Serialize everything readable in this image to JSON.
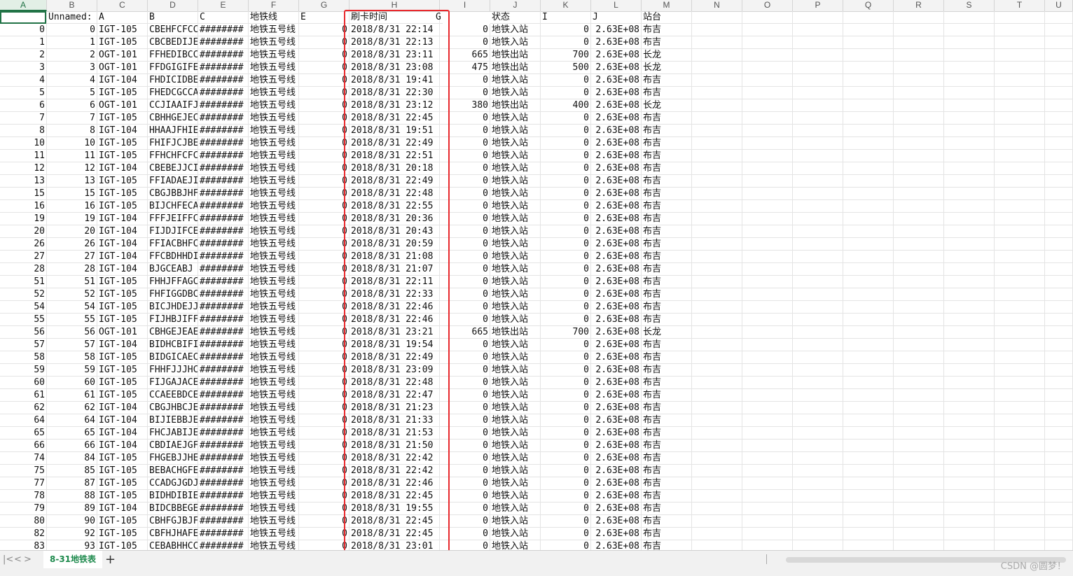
{
  "columns": [
    "A",
    "B",
    "C",
    "D",
    "E",
    "F",
    "G",
    "H",
    "I",
    "J",
    "K",
    "L",
    "M",
    "N",
    "O",
    "P",
    "Q",
    "R",
    "S",
    "T",
    "U"
  ],
  "header_row": {
    "B": "Unnamed:",
    "C": "A",
    "D": "B",
    "E": "C",
    "F": "地铁线",
    "G": "E",
    "H": "刷卡时间",
    "H_tail": "G",
    "J": "状态",
    "K": "I",
    "L": "J",
    "M": "站台"
  },
  "rows": [
    {
      "n": "0",
      "b": "0",
      "c": "IGT-105",
      "d": "CBEHFCFCC",
      "e": "########",
      "f": "地铁五号线",
      "g": "0",
      "h": "2018/8/31  22:14",
      "i": "0",
      "j": "地铁入站",
      "k": "0",
      "l": "2.63E+08",
      "m": "布吉"
    },
    {
      "n": "1",
      "b": "1",
      "c": "IGT-105",
      "d": "CBCBEDIJE",
      "e": "########",
      "f": "地铁五号线",
      "g": "0",
      "h": "2018/8/31  22:13",
      "i": "0",
      "j": "地铁入站",
      "k": "0",
      "l": "2.63E+08",
      "m": "布吉"
    },
    {
      "n": "2",
      "b": "2",
      "c": "OGT-101",
      "d": "FFHEDIBCC",
      "e": "########",
      "f": "地铁五号线",
      "g": "0",
      "h": "2018/8/31  23:11",
      "i": "665",
      "j": "地铁出站",
      "k": "700",
      "l": "2.63E+08",
      "m": "长龙"
    },
    {
      "n": "3",
      "b": "3",
      "c": "OGT-101",
      "d": "FFDGIGIFE",
      "e": "########",
      "f": "地铁五号线",
      "g": "0",
      "h": "2018/8/31  23:08",
      "i": "475",
      "j": "地铁出站",
      "k": "500",
      "l": "2.63E+08",
      "m": "长龙"
    },
    {
      "n": "4",
      "b": "4",
      "c": "IGT-104",
      "d": "FHDICIDBE",
      "e": "########",
      "f": "地铁五号线",
      "g": "0",
      "h": "2018/8/31  19:41",
      "i": "0",
      "j": "地铁入站",
      "k": "0",
      "l": "2.63E+08",
      "m": "布吉"
    },
    {
      "n": "5",
      "b": "5",
      "c": "IGT-105",
      "d": "FHEDCGCCA",
      "e": "########",
      "f": "地铁五号线",
      "g": "0",
      "h": "2018/8/31  22:30",
      "i": "0",
      "j": "地铁入站",
      "k": "0",
      "l": "2.63E+08",
      "m": "布吉"
    },
    {
      "n": "6",
      "b": "6",
      "c": "OGT-101",
      "d": "CCJIAAIFJ",
      "e": "########",
      "f": "地铁五号线",
      "g": "0",
      "h": "2018/8/31  23:12",
      "i": "380",
      "j": "地铁出站",
      "k": "400",
      "l": "2.63E+08",
      "m": "长龙"
    },
    {
      "n": "7",
      "b": "7",
      "c": "IGT-105",
      "d": "CBHHGEJEC",
      "e": "########",
      "f": "地铁五号线",
      "g": "0",
      "h": "2018/8/31  22:45",
      "i": "0",
      "j": "地铁入站",
      "k": "0",
      "l": "2.63E+08",
      "m": "布吉"
    },
    {
      "n": "8",
      "b": "8",
      "c": "IGT-104",
      "d": "HHAAJFHIE",
      "e": "########",
      "f": "地铁五号线",
      "g": "0",
      "h": "2018/8/31  19:51",
      "i": "0",
      "j": "地铁入站",
      "k": "0",
      "l": "2.63E+08",
      "m": "布吉"
    },
    {
      "n": "10",
      "b": "10",
      "c": "IGT-105",
      "d": "FHIFJCJBE",
      "e": "########",
      "f": "地铁五号线",
      "g": "0",
      "h": "2018/8/31  22:49",
      "i": "0",
      "j": "地铁入站",
      "k": "0",
      "l": "2.63E+08",
      "m": "布吉"
    },
    {
      "n": "11",
      "b": "11",
      "c": "IGT-105",
      "d": "FFHCHFCFC",
      "e": "########",
      "f": "地铁五号线",
      "g": "0",
      "h": "2018/8/31  22:51",
      "i": "0",
      "j": "地铁入站",
      "k": "0",
      "l": "2.63E+08",
      "m": "布吉"
    },
    {
      "n": "12",
      "b": "12",
      "c": "IGT-104",
      "d": "CBEBEJJCI",
      "e": "########",
      "f": "地铁五号线",
      "g": "0",
      "h": "2018/8/31  20:18",
      "i": "0",
      "j": "地铁入站",
      "k": "0",
      "l": "2.63E+08",
      "m": "布吉"
    },
    {
      "n": "13",
      "b": "13",
      "c": "IGT-105",
      "d": "FFIADAEJI",
      "e": "########",
      "f": "地铁五号线",
      "g": "0",
      "h": "2018/8/31  22:49",
      "i": "0",
      "j": "地铁入站",
      "k": "0",
      "l": "2.63E+08",
      "m": "布吉"
    },
    {
      "n": "15",
      "b": "15",
      "c": "IGT-105",
      "d": "CBGJBBJHF",
      "e": "########",
      "f": "地铁五号线",
      "g": "0",
      "h": "2018/8/31  22:48",
      "i": "0",
      "j": "地铁入站",
      "k": "0",
      "l": "2.63E+08",
      "m": "布吉"
    },
    {
      "n": "16",
      "b": "16",
      "c": "IGT-105",
      "d": "BIJCHFECA",
      "e": "########",
      "f": "地铁五号线",
      "g": "0",
      "h": "2018/8/31  22:55",
      "i": "0",
      "j": "地铁入站",
      "k": "0",
      "l": "2.63E+08",
      "m": "布吉"
    },
    {
      "n": "19",
      "b": "19",
      "c": "IGT-104",
      "d": "FFFJEIFFC",
      "e": "########",
      "f": "地铁五号线",
      "g": "0",
      "h": "2018/8/31  20:36",
      "i": "0",
      "j": "地铁入站",
      "k": "0",
      "l": "2.63E+08",
      "m": "布吉"
    },
    {
      "n": "20",
      "b": "20",
      "c": "IGT-104",
      "d": "FIJDJIFCE",
      "e": "########",
      "f": "地铁五号线",
      "g": "0",
      "h": "2018/8/31  20:43",
      "i": "0",
      "j": "地铁入站",
      "k": "0",
      "l": "2.63E+08",
      "m": "布吉"
    },
    {
      "n": "26",
      "b": "26",
      "c": "IGT-104",
      "d": "FFIACBHFC",
      "e": "########",
      "f": "地铁五号线",
      "g": "0",
      "h": "2018/8/31  20:59",
      "i": "0",
      "j": "地铁入站",
      "k": "0",
      "l": "2.63E+08",
      "m": "布吉"
    },
    {
      "n": "27",
      "b": "27",
      "c": "IGT-104",
      "d": "FFCBDHHDI",
      "e": "########",
      "f": "地铁五号线",
      "g": "0",
      "h": "2018/8/31  21:08",
      "i": "0",
      "j": "地铁入站",
      "k": "0",
      "l": "2.63E+08",
      "m": "布吉"
    },
    {
      "n": "28",
      "b": "28",
      "c": "IGT-104",
      "d": "BJGCEABJ",
      "e": "########",
      "f": "地铁五号线",
      "g": "0",
      "h": "2018/8/31  21:07",
      "i": "0",
      "j": "地铁入站",
      "k": "0",
      "l": "2.63E+08",
      "m": "布吉"
    },
    {
      "n": "51",
      "b": "51",
      "c": "IGT-105",
      "d": "FHHJFFAGC",
      "e": "########",
      "f": "地铁五号线",
      "g": "0",
      "h": "2018/8/31  22:11",
      "i": "0",
      "j": "地铁入站",
      "k": "0",
      "l": "2.63E+08",
      "m": "布吉"
    },
    {
      "n": "52",
      "b": "52",
      "c": "IGT-105",
      "d": "FHFIGGDBC",
      "e": "########",
      "f": "地铁五号线",
      "g": "0",
      "h": "2018/8/31  22:33",
      "i": "0",
      "j": "地铁入站",
      "k": "0",
      "l": "2.63E+08",
      "m": "布吉"
    },
    {
      "n": "54",
      "b": "54",
      "c": "IGT-105",
      "d": "BICJHDEJJ",
      "e": "########",
      "f": "地铁五号线",
      "g": "0",
      "h": "2018/8/31  22:46",
      "i": "0",
      "j": "地铁入站",
      "k": "0",
      "l": "2.63E+08",
      "m": "布吉"
    },
    {
      "n": "55",
      "b": "55",
      "c": "IGT-105",
      "d": "FIJHBJIFF",
      "e": "########",
      "f": "地铁五号线",
      "g": "0",
      "h": "2018/8/31  22:46",
      "i": "0",
      "j": "地铁入站",
      "k": "0",
      "l": "2.63E+08",
      "m": "布吉"
    },
    {
      "n": "56",
      "b": "56",
      "c": "OGT-101",
      "d": "CBHGEJEAE",
      "e": "########",
      "f": "地铁五号线",
      "g": "0",
      "h": "2018/8/31  23:21",
      "i": "665",
      "j": "地铁出站",
      "k": "700",
      "l": "2.63E+08",
      "m": "长龙"
    },
    {
      "n": "57",
      "b": "57",
      "c": "IGT-104",
      "d": "BIDHCBIFI",
      "e": "########",
      "f": "地铁五号线",
      "g": "0",
      "h": "2018/8/31  19:54",
      "i": "0",
      "j": "地铁入站",
      "k": "0",
      "l": "2.63E+08",
      "m": "布吉"
    },
    {
      "n": "58",
      "b": "58",
      "c": "IGT-105",
      "d": "BIDGICAEC",
      "e": "########",
      "f": "地铁五号线",
      "g": "0",
      "h": "2018/8/31  22:49",
      "i": "0",
      "j": "地铁入站",
      "k": "0",
      "l": "2.63E+08",
      "m": "布吉"
    },
    {
      "n": "59",
      "b": "59",
      "c": "IGT-105",
      "d": "FHHFJJJHC",
      "e": "########",
      "f": "地铁五号线",
      "g": "0",
      "h": "2018/8/31  23:09",
      "i": "0",
      "j": "地铁入站",
      "k": "0",
      "l": "2.63E+08",
      "m": "布吉"
    },
    {
      "n": "60",
      "b": "60",
      "c": "IGT-105",
      "d": "FIJGAJACE",
      "e": "########",
      "f": "地铁五号线",
      "g": "0",
      "h": "2018/8/31  22:48",
      "i": "0",
      "j": "地铁入站",
      "k": "0",
      "l": "2.63E+08",
      "m": "布吉"
    },
    {
      "n": "61",
      "b": "61",
      "c": "IGT-105",
      "d": "CCAEEBDCE",
      "e": "########",
      "f": "地铁五号线",
      "g": "0",
      "h": "2018/8/31  22:47",
      "i": "0",
      "j": "地铁入站",
      "k": "0",
      "l": "2.63E+08",
      "m": "布吉"
    },
    {
      "n": "62",
      "b": "62",
      "c": "IGT-104",
      "d": "CBGJHBCJE",
      "e": "########",
      "f": "地铁五号线",
      "g": "0",
      "h": "2018/8/31  21:23",
      "i": "0",
      "j": "地铁入站",
      "k": "0",
      "l": "2.63E+08",
      "m": "布吉"
    },
    {
      "n": "64",
      "b": "64",
      "c": "IGT-104",
      "d": "BIJIEBBJE",
      "e": "########",
      "f": "地铁五号线",
      "g": "0",
      "h": "2018/8/31  21:33",
      "i": "0",
      "j": "地铁入站",
      "k": "0",
      "l": "2.63E+08",
      "m": "布吉"
    },
    {
      "n": "65",
      "b": "65",
      "c": "IGT-104",
      "d": "FHCJABIJE",
      "e": "########",
      "f": "地铁五号线",
      "g": "0",
      "h": "2018/8/31  21:53",
      "i": "0",
      "j": "地铁入站",
      "k": "0",
      "l": "2.63E+08",
      "m": "布吉"
    },
    {
      "n": "66",
      "b": "66",
      "c": "IGT-104",
      "d": "CBDIAEJGF",
      "e": "########",
      "f": "地铁五号线",
      "g": "0",
      "h": "2018/8/31  21:50",
      "i": "0",
      "j": "地铁入站",
      "k": "0",
      "l": "2.63E+08",
      "m": "布吉"
    },
    {
      "n": "74",
      "b": "84",
      "c": "IGT-105",
      "d": "FHGEBJJHE",
      "e": "########",
      "f": "地铁五号线",
      "g": "0",
      "h": "2018/8/31  22:42",
      "i": "0",
      "j": "地铁入站",
      "k": "0",
      "l": "2.63E+08",
      "m": "布吉"
    },
    {
      "n": "75",
      "b": "85",
      "c": "IGT-105",
      "d": "BEBACHGFE",
      "e": "########",
      "f": "地铁五号线",
      "g": "0",
      "h": "2018/8/31  22:42",
      "i": "0",
      "j": "地铁入站",
      "k": "0",
      "l": "2.63E+08",
      "m": "布吉"
    },
    {
      "n": "77",
      "b": "87",
      "c": "IGT-105",
      "d": "CCADGJGDJ",
      "e": "########",
      "f": "地铁五号线",
      "g": "0",
      "h": "2018/8/31  22:46",
      "i": "0",
      "j": "地铁入站",
      "k": "0",
      "l": "2.63E+08",
      "m": "布吉"
    },
    {
      "n": "78",
      "b": "88",
      "c": "IGT-105",
      "d": "BIDHDIBIE",
      "e": "########",
      "f": "地铁五号线",
      "g": "0",
      "h": "2018/8/31  22:45",
      "i": "0",
      "j": "地铁入站",
      "k": "0",
      "l": "2.63E+08",
      "m": "布吉"
    },
    {
      "n": "79",
      "b": "89",
      "c": "IGT-104",
      "d": "BIDCBBEGE",
      "e": "########",
      "f": "地铁五号线",
      "g": "0",
      "h": "2018/8/31  19:55",
      "i": "0",
      "j": "地铁入站",
      "k": "0",
      "l": "2.63E+08",
      "m": "布吉"
    },
    {
      "n": "80",
      "b": "90",
      "c": "IGT-105",
      "d": "CBHFGJBJF",
      "e": "########",
      "f": "地铁五号线",
      "g": "0",
      "h": "2018/8/31  22:45",
      "i": "0",
      "j": "地铁入站",
      "k": "0",
      "l": "2.63E+08",
      "m": "布吉"
    },
    {
      "n": "82",
      "b": "92",
      "c": "IGT-105",
      "d": "CBFHJHAFE",
      "e": "########",
      "f": "地铁五号线",
      "g": "0",
      "h": "2018/8/31  22:45",
      "i": "0",
      "j": "地铁入站",
      "k": "0",
      "l": "2.63E+08",
      "m": "布吉"
    },
    {
      "n": "83",
      "b": "93",
      "c": "IGT-105",
      "d": "CEBABHHCC",
      "e": "########",
      "f": "地铁五号线",
      "g": "0",
      "h": "2018/8/31  23:01",
      "i": "0",
      "j": "地铁入站",
      "k": "0",
      "l": "2.63E+08",
      "m": "布吉"
    }
  ],
  "sheet_tab": "8-31地铁表",
  "nav": {
    "first": "|<",
    "prev": "<",
    "next": ">",
    "last": ">|",
    "add": "+"
  },
  "watermark": "CSDN @圆梦！",
  "colors": {
    "highlight_box": "#e8292d",
    "accent": "#217346",
    "tab_text": "#1e8a4d"
  }
}
